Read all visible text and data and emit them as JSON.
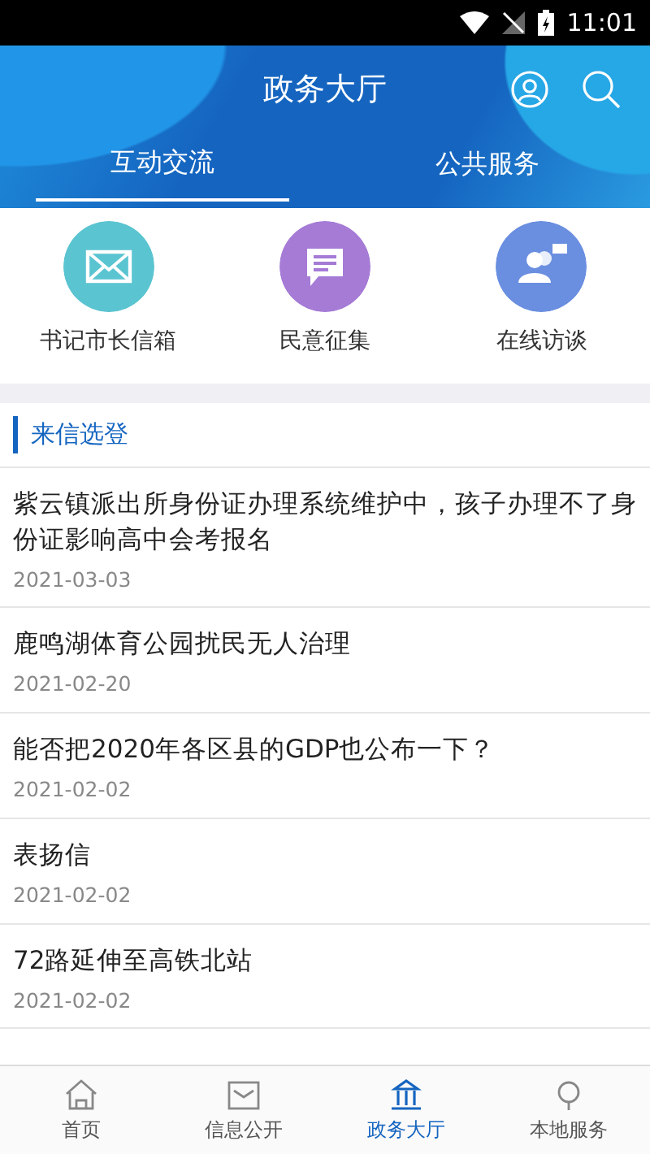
{
  "status_bar": {
    "time": "11:01"
  },
  "header": {
    "title": "政务大厅"
  },
  "tabs": [
    {
      "label": "互动交流",
      "selected": true
    },
    {
      "label": "公共服务",
      "selected": false
    }
  ],
  "shortcuts": [
    {
      "label": "书记市长信箱",
      "kind": "mail",
      "color": "#5bc4d1"
    },
    {
      "label": "民意征集",
      "kind": "chat",
      "color": "#a57bd6"
    },
    {
      "label": "在线访谈",
      "kind": "people",
      "color": "#6a8fe0"
    }
  ],
  "section": {
    "title": "来信选登"
  },
  "letters": [
    {
      "title": "紫云镇派出所身份证办理系统维护中，孩子办理不了身份证影响高中会考报名",
      "date": "2021-03-03"
    },
    {
      "title": "鹿鸣湖体育公园扰民无人治理",
      "date": "2021-02-20"
    },
    {
      "title": "能否把2020年各区县的GDP也公布一下？",
      "date": "2021-02-02"
    },
    {
      "title": "表扬信",
      "date": "2021-02-02"
    },
    {
      "title": "72路延伸至高铁北站",
      "date": "2021-02-02"
    }
  ],
  "bottom_nav": [
    {
      "label": "首页",
      "kind": "home",
      "selected": false
    },
    {
      "label": "信息公开",
      "kind": "info",
      "selected": false
    },
    {
      "label": "政务大厅",
      "kind": "hall",
      "selected": true
    },
    {
      "label": "本地服务",
      "kind": "service",
      "selected": false
    }
  ]
}
